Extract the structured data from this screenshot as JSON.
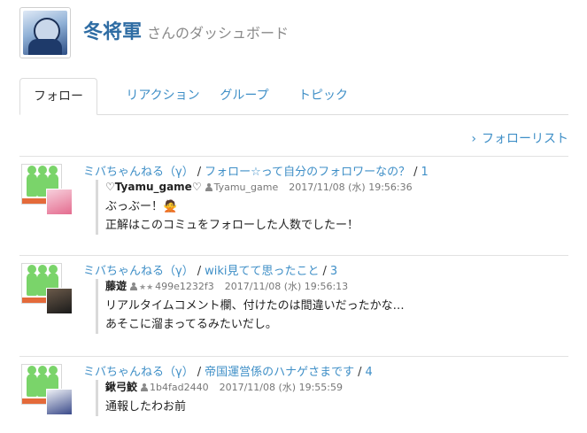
{
  "header": {
    "name": "冬将軍",
    "suffix": "さんのダッシュボード"
  },
  "tabs": [
    {
      "label": "フォロー",
      "active": true
    },
    {
      "label": "リアクション",
      "active": false
    },
    {
      "label": "グループ",
      "active": false
    },
    {
      "label": "トピック",
      "active": false
    }
  ],
  "follow_list": {
    "chevron": "›",
    "label": "フォローリスト"
  },
  "colors": {
    "link": "#3f8fc7",
    "title": "#2f6da4",
    "community_bar": "#e46a3a",
    "community_figures": "#7ad46a"
  },
  "feed": [
    {
      "community": "ミバちゃんねる（γ）",
      "sep": "/",
      "topic": "フォロー☆って自分のフォロワーなの？",
      "count_sep": "/",
      "count": "1",
      "user": "♡Tyamu_game♡",
      "user_icon_name": "person-icon",
      "stars": "",
      "user_id": "Tyamu_game",
      "timestamp": "2017/11/08 (水) 19:56:36",
      "lines": [
        "ぶっぶー！🙅",
        "正解はこのコミュをフォローした人数でしたー！"
      ],
      "avatar_colors": [
        "#f4b6c8",
        "#e46c8f"
      ]
    },
    {
      "community": "ミバちゃんねる（γ）",
      "sep": "/",
      "topic": "wiki見てて思ったこと",
      "count_sep": "/",
      "count": "3",
      "user": "藤遊",
      "user_icon_name": "person-icon",
      "stars": "★★",
      "user_id": "499e1232f3",
      "timestamp": "2017/11/08 (水) 19:56:13",
      "lines": [
        "リアルタイムコメント欄、付けたのは間違いだったかな…",
        "あそこに溜まってるみたいだし。"
      ],
      "avatar_colors": [
        "#2a2a2a",
        "#6b5a4a"
      ]
    },
    {
      "community": "ミバちゃんねる（γ）",
      "sep": "/",
      "topic": "帝国運営係のハナゲさまです",
      "count_sep": "/",
      "count": "4",
      "user": "鍬弓鮫",
      "user_icon_name": "person-icon",
      "stars": "",
      "user_id": "1b4fad2440",
      "timestamp": "2017/11/08 (水) 19:55:59",
      "lines": [
        "通報したわお前"
      ],
      "avatar_colors": [
        "#e9edf4",
        "#3a4a8a"
      ]
    }
  ]
}
